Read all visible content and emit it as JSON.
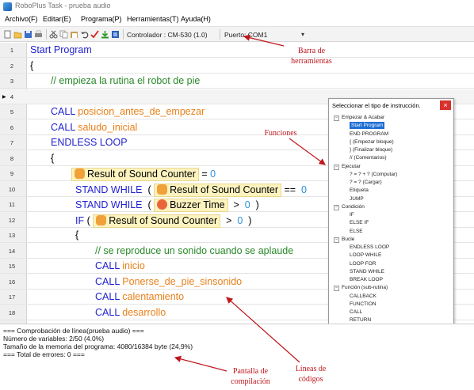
{
  "window": {
    "title": "RoboPlus Task - prueba audio"
  },
  "menu": [
    "Archivo(F)",
    "Editar(E)",
    "Programa(P)",
    "Herramientas(T)",
    "Ayuda(H)"
  ],
  "toolbar": {
    "icons": [
      "new-file-icon",
      "open-folder-icon",
      "save-icon",
      "print-icon",
      "cut-icon",
      "copy-icon",
      "paste-icon",
      "undo-icon",
      "check-icon",
      "download-icon",
      "debug-icon"
    ],
    "controller": "Controlador : CM-530 (1.0)",
    "port": "Puerto:  COM1",
    "dropdown": "▾"
  },
  "editor": {
    "lines": [
      {
        "n": "1",
        "indent": 0,
        "parts": [
          {
            "t": "Start Program",
            "c": "kw"
          }
        ]
      },
      {
        "n": "2",
        "indent": 0,
        "parts": [
          {
            "t": "{",
            "c": "blk"
          }
        ]
      },
      {
        "n": "3",
        "indent": 1,
        "parts": [
          {
            "t": "// empieza la rutina el robot de pie",
            "c": "cm"
          }
        ]
      },
      {
        "n": "4",
        "indent": 0,
        "current": true,
        "parts": []
      },
      {
        "n": "5",
        "indent": 1,
        "parts": [
          {
            "t": "CALL ",
            "c": "kw"
          },
          {
            "t": "posicion_antes_de_empezar",
            "c": "fn"
          }
        ]
      },
      {
        "n": "6",
        "indent": 1,
        "parts": [
          {
            "t": "CALL ",
            "c": "kw"
          },
          {
            "t": "saludo_inicial",
            "c": "fn"
          }
        ]
      },
      {
        "n": "7",
        "indent": 1,
        "parts": [
          {
            "t": "ENDLESS LOOP",
            "c": "kw"
          }
        ]
      },
      {
        "n": "8",
        "indent": 1,
        "parts": [
          {
            "t": "{",
            "c": "blk"
          }
        ]
      },
      {
        "n": "9",
        "indent": 2,
        "parts": [
          {
            "tag": "Result of Sound Counter",
            "icon": "hand"
          },
          {
            "t": " = ",
            "c": "blk"
          },
          {
            "t": "0",
            "c": "num"
          }
        ]
      },
      {
        "n": "10",
        "indent": 3,
        "parts": [
          {
            "t": "STAND WHILE ",
            "c": "kw"
          },
          {
            "t": " ( ",
            "c": "blk"
          },
          {
            "tag": "Result of Sound Counter",
            "icon": "hand"
          },
          {
            "t": " == ",
            "c": "blk"
          },
          {
            "t": " 0",
            "c": "num"
          }
        ]
      },
      {
        "n": "11",
        "indent": 3,
        "parts": [
          {
            "t": "STAND WHILE ",
            "c": "kw"
          },
          {
            "t": " ( ",
            "c": "blk"
          },
          {
            "tag": "Buzzer Time",
            "icon": "buzz"
          },
          {
            "t": "  >  ",
            "c": "blk"
          },
          {
            "t": "0",
            "c": "num"
          },
          {
            "t": "  )",
            "c": "blk"
          }
        ]
      },
      {
        "n": "12",
        "indent": 3,
        "parts": [
          {
            "t": "IF ",
            "c": "kw"
          },
          {
            "t": "( ",
            "c": "blk"
          },
          {
            "tag": "Result of Sound Counter",
            "icon": "hand"
          },
          {
            "t": "  >  ",
            "c": "blk"
          },
          {
            "t": "0",
            "c": "num"
          },
          {
            "t": "  )",
            "c": "blk"
          }
        ]
      },
      {
        "n": "13",
        "indent": 3,
        "parts": [
          {
            "t": "{",
            "c": "blk"
          }
        ]
      },
      {
        "n": "14",
        "indent": 4,
        "parts": [
          {
            "t": "// se reproduce un sonido cuando se aplaude",
            "c": "cm"
          }
        ]
      },
      {
        "n": "15",
        "indent": 4,
        "parts": [
          {
            "t": "CALL ",
            "c": "kw"
          },
          {
            "t": "inicio",
            "c": "fn"
          }
        ]
      },
      {
        "n": "16",
        "indent": 4,
        "parts": [
          {
            "t": "CALL ",
            "c": "kw"
          },
          {
            "t": "Ponerse_de_pie_sinsonido",
            "c": "fn"
          }
        ]
      },
      {
        "n": "17",
        "indent": 4,
        "parts": [
          {
            "t": "CALL ",
            "c": "kw"
          },
          {
            "t": "calentamiento",
            "c": "fn"
          }
        ]
      },
      {
        "n": "18",
        "indent": 4,
        "parts": [
          {
            "t": "CALL ",
            "c": "kw"
          },
          {
            "t": "desarrollo",
            "c": "fn"
          }
        ]
      }
    ]
  },
  "panel": {
    "title": "Seleccionar el tipo de instrucción.",
    "close": "×",
    "tree": [
      {
        "label": "Empezar & Acabar",
        "level": 0,
        "group": true
      },
      {
        "label": "Start Program",
        "level": 1,
        "selected": true
      },
      {
        "label": "END PROGRAM",
        "level": 1
      },
      {
        "label": "{  (Empezar bloque)",
        "level": 1
      },
      {
        "label": "}  (Finalizar bloque)",
        "level": 1
      },
      {
        "label": "//  (Comentarios)",
        "level": 1
      },
      {
        "label": "Ejecutar",
        "level": 0,
        "group": true
      },
      {
        "label": "? = ? + ?  (Computar)",
        "level": 1
      },
      {
        "label": "? = ?  (Cargar)",
        "level": 1
      },
      {
        "label": "Etiqueta",
        "level": 1
      },
      {
        "label": "JUMP",
        "level": 1
      },
      {
        "label": "Condición",
        "level": 0,
        "group": true
      },
      {
        "label": "IF",
        "level": 1
      },
      {
        "label": "ELSE IF",
        "level": 1
      },
      {
        "label": "ELSE",
        "level": 1
      },
      {
        "label": "Bucle",
        "level": 0,
        "group": true
      },
      {
        "label": "ENDLESS LOOP",
        "level": 1
      },
      {
        "label": "LOOP WHILE",
        "level": 1
      },
      {
        "label": "LOOP FOR",
        "level": 1
      },
      {
        "label": "STAND WHILE",
        "level": 1
      },
      {
        "label": "BREAK LOOP",
        "level": 1
      },
      {
        "label": "Función (sub-rutina)",
        "level": 0,
        "group": true
      },
      {
        "label": "CALLBACK",
        "level": 1
      },
      {
        "label": "FUNCTION",
        "level": 1
      },
      {
        "label": "CALL",
        "level": 1
      },
      {
        "label": "RETURN",
        "level": 1
      }
    ]
  },
  "output": {
    "lines": [
      "=== Comprobación de línea(prueba audio) ===",
      "Número de variables: 2/50 (4.0%)",
      "Tamaño de la memoria del programa: 4080/16384 byte (24,9%)",
      "=== Total de errores: 0 ==="
    ]
  },
  "annotations": {
    "toolbar_label": "Barra de herramientas",
    "functions_label": "Funciones",
    "compile_label": "Pantalla de compilación",
    "lines_label": "Líneas de códigos",
    "color": "#c0161c"
  }
}
